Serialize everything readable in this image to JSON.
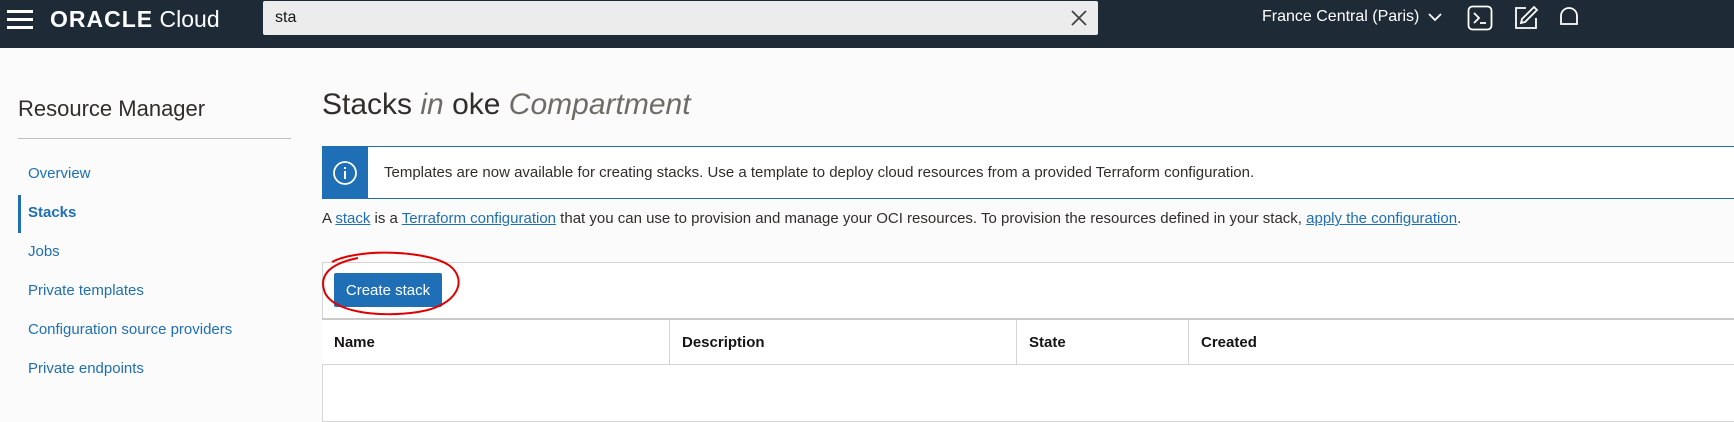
{
  "header": {
    "logo_brand": "ORACLE",
    "logo_product": "Cloud",
    "search_value": "sta",
    "region": "France Central (Paris)",
    "icons": [
      "menu-icon",
      "close-icon",
      "chevron-down-icon",
      "cloud-shell-icon",
      "edit-icon",
      "bell-icon"
    ]
  },
  "sidebar": {
    "title": "Resource Manager",
    "items": [
      {
        "label": "Overview"
      },
      {
        "label": "Stacks"
      },
      {
        "label": "Jobs"
      },
      {
        "label": "Private templates"
      },
      {
        "label": "Configuration source providers"
      },
      {
        "label": "Private endpoints"
      }
    ],
    "active_item": "Stacks"
  },
  "main": {
    "title": {
      "main": "Stacks",
      "in": "in",
      "compartment": "oke",
      "suffix": "Compartment"
    },
    "info_banner": "Templates are now available for creating stacks. Use a template to deploy cloud resources from a provided Terraform configuration.",
    "description": {
      "p1": "A ",
      "link1": "stack",
      "p2": " is a ",
      "link2": "Terraform configuration",
      "p3": " that you can use to provision and manage your OCI resources. To provision the resources defined in your stack, ",
      "link3": "apply the configuration",
      "p4": "."
    },
    "create_button": "Create stack",
    "table": {
      "columns": [
        "Name",
        "Description",
        "State",
        "Created"
      ]
    }
  },
  "colors": {
    "topbar": "#1e2a36",
    "accent": "#1e6fb5",
    "annotation": "#e00000"
  }
}
